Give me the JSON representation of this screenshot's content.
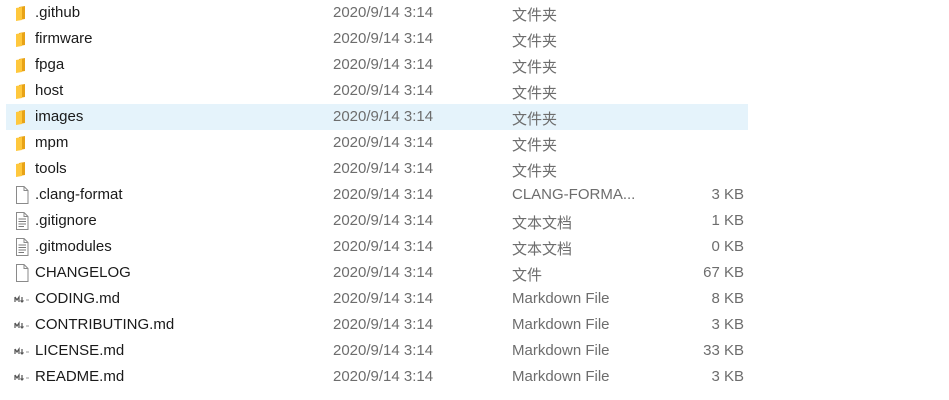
{
  "file_list": {
    "items": [
      {
        "name": ".github",
        "date": "2020/9/14 3:14",
        "type": "文件夹",
        "size": "",
        "icon": "folder-icon",
        "selected": false
      },
      {
        "name": "firmware",
        "date": "2020/9/14 3:14",
        "type": "文件夹",
        "size": "",
        "icon": "folder-icon",
        "selected": false
      },
      {
        "name": "fpga",
        "date": "2020/9/14 3:14",
        "type": "文件夹",
        "size": "",
        "icon": "folder-icon",
        "selected": false
      },
      {
        "name": "host",
        "date": "2020/9/14 3:14",
        "type": "文件夹",
        "size": "",
        "icon": "folder-icon",
        "selected": false
      },
      {
        "name": "images",
        "date": "2020/9/14 3:14",
        "type": "文件夹",
        "size": "",
        "icon": "folder-icon",
        "selected": true
      },
      {
        "name": "mpm",
        "date": "2020/9/14 3:14",
        "type": "文件夹",
        "size": "",
        "icon": "folder-icon",
        "selected": false
      },
      {
        "name": "tools",
        "date": "2020/9/14 3:14",
        "type": "文件夹",
        "size": "",
        "icon": "folder-icon",
        "selected": false
      },
      {
        "name": ".clang-format",
        "date": "2020/9/14 3:14",
        "type": "CLANG-FORMA...",
        "size": "3 KB",
        "icon": "file-icon",
        "selected": false
      },
      {
        "name": ".gitignore",
        "date": "2020/9/14 3:14",
        "type": "文本文档",
        "size": "1 KB",
        "icon": "text-file-icon",
        "selected": false
      },
      {
        "name": ".gitmodules",
        "date": "2020/9/14 3:14",
        "type": "文本文档",
        "size": "0 KB",
        "icon": "text-file-icon",
        "selected": false
      },
      {
        "name": "CHANGELOG",
        "date": "2020/9/14 3:14",
        "type": "文件",
        "size": "67 KB",
        "icon": "file-icon",
        "selected": false
      },
      {
        "name": "CODING.md",
        "date": "2020/9/14 3:14",
        "type": "Markdown File",
        "size": "8 KB",
        "icon": "markdown-file-icon",
        "selected": false
      },
      {
        "name": "CONTRIBUTING.md",
        "date": "2020/9/14 3:14",
        "type": "Markdown File",
        "size": "3 KB",
        "icon": "markdown-file-icon",
        "selected": false
      },
      {
        "name": "LICENSE.md",
        "date": "2020/9/14 3:14",
        "type": "Markdown File",
        "size": "33 KB",
        "icon": "markdown-file-icon",
        "selected": false
      },
      {
        "name": "README.md",
        "date": "2020/9/14 3:14",
        "type": "Markdown File",
        "size": "3 KB",
        "icon": "markdown-file-icon",
        "selected": false
      }
    ]
  },
  "colors": {
    "selection": "#e5f3fb",
    "folder": "#ffc83d",
    "secondary_text": "#6d6d6d"
  }
}
